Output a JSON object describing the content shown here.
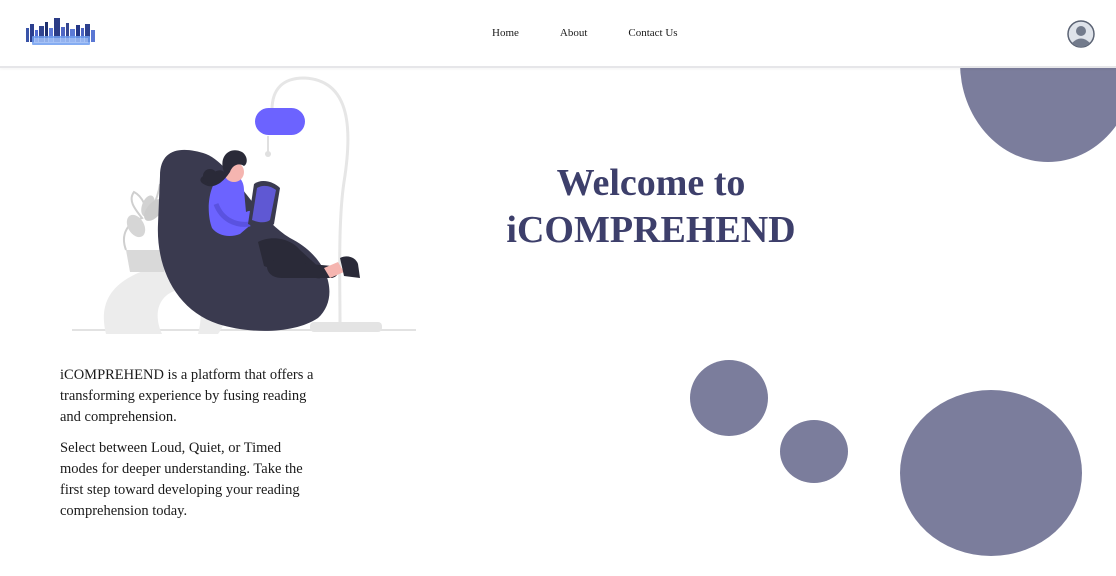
{
  "colors": {
    "primary": "#3d3f6b",
    "circle": "#7b7d9c",
    "accent": "#6c63ff",
    "text": "#1a1a1a"
  },
  "header": {
    "logo": "iComprehend",
    "nav": [
      {
        "label": "Home"
      },
      {
        "label": "About"
      },
      {
        "label": "Contact Us"
      }
    ],
    "avatar_icon": "user-avatar-icon"
  },
  "hero": {
    "title_line1": "Welcome to",
    "title_line2": "iCOMPREHEND"
  },
  "illustration": {
    "icon": "woman-reading-illustration"
  },
  "intro": {
    "paragraph1": "iCOMPREHEND is a platform that offers a transforming experience by fusing reading and comprehension.",
    "paragraph2": "Select between Loud, Quiet, or Timed modes for deeper understanding. Take the first step toward developing your reading comprehension today."
  }
}
